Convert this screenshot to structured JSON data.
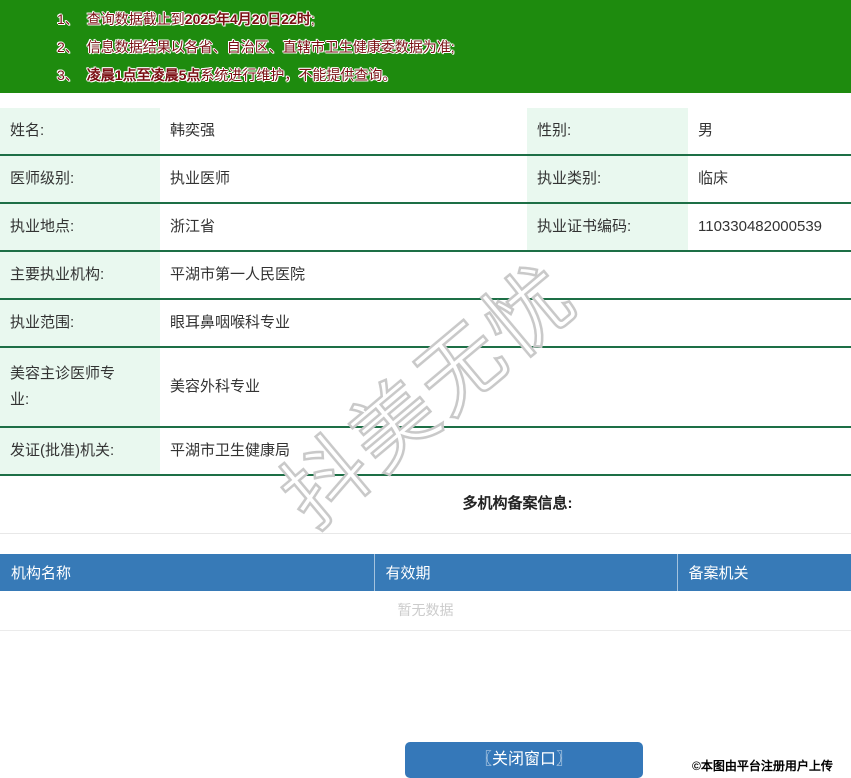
{
  "notice": {
    "items": [
      {
        "num": "1、",
        "pre": "查询数据截止到",
        "bold": "2025年4月20日22时",
        "post": ";"
      },
      {
        "num": "2、",
        "pre": "信息数据结果以各省、自治区、直辖市卫生健康委数据为准;",
        "bold": "",
        "post": ""
      },
      {
        "num": "3、",
        "pre": "",
        "bold": "凌晨1点至凌晨5点",
        "post": "系统进行维护，不能提供查询。"
      }
    ]
  },
  "info": {
    "rows2col": [
      {
        "l1": "姓名:",
        "v1": "韩奕强",
        "l2": "性别:",
        "v2": "男"
      },
      {
        "l1": "医师级别:",
        "v1": "执业医师",
        "l2": "执业类别:",
        "v2": "临床"
      },
      {
        "l1": "执业地点:",
        "v1": "浙江省",
        "l2": "执业证书编码:",
        "v2": "110330482000539"
      }
    ],
    "rows1col": [
      {
        "label": "主要执业机构:",
        "value": "平湖市第一人民医院"
      },
      {
        "label": "执业范围:",
        "value": "眼耳鼻咽喉科专业"
      },
      {
        "label": "美容主诊医师专业:",
        "value": "美容外科专业"
      },
      {
        "label": "发证(批准)机关:",
        "value": "平湖市卫生健康局"
      }
    ]
  },
  "records": {
    "title": "多机构备案信息:",
    "columns": [
      "机构名称",
      "有效期",
      "备案机关"
    ],
    "empty_text": "暂无数据"
  },
  "footer": {
    "close_button": "〖关闭窗口〗",
    "credit": "©本图由平台注册用户上传"
  },
  "watermark": "抖美无忧",
  "colors": {
    "banner_bg": "#1e8b0e",
    "banner_text": "#7a0e12",
    "label_cell_bg": "#e9f8ef",
    "row_border": "#1d6f46",
    "table_header_bg": "#377ab7",
    "button_bg": "#3578b9",
    "empty_text": "#cccccc"
  }
}
